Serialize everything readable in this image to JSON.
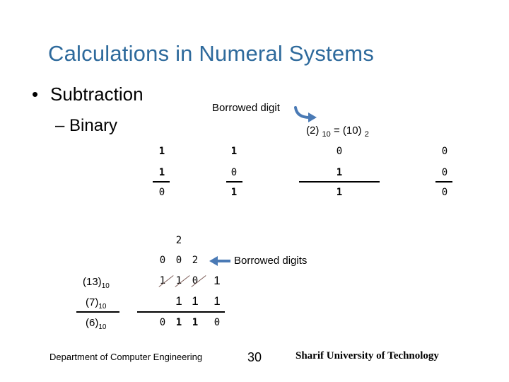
{
  "slide": {
    "title": "Calculations in Numeral Systems",
    "bullet_level1": "Subtraction",
    "bullet_level1_marker": "•",
    "bullet_level2": "Binary",
    "bullet_level2_marker": "–",
    "annotation_top": "Borrowed digit",
    "equation": {
      "left": "(2)",
      "left_base": "10",
      "equals": "=",
      "right": "(10)",
      "right_base": "2"
    },
    "columns": [
      {
        "minuend": "1",
        "subtrahend": "1",
        "result": "0"
      },
      {
        "minuend": "1",
        "subtrahend": "0",
        "result": "1"
      },
      {
        "minuend": "0",
        "subtrahend": "1",
        "result": "1"
      },
      {
        "minuend": "0",
        "subtrahend": "0",
        "result": "0"
      }
    ],
    "example": {
      "top_borrow": "2",
      "borrowed_digits": [
        "0",
        "0",
        "2"
      ],
      "borrowed_label": "Borrowed digits",
      "minuend_label": "(13)",
      "minuend_base": "10",
      "minuend_digits": [
        "1",
        "1",
        "0",
        "1"
      ],
      "subtrahend_label": "(7)",
      "subtrahend_base": "10",
      "subtrahend_digits": [
        "1",
        "1",
        "1"
      ],
      "result_label": "(6)",
      "result_base": "10",
      "result_digits": [
        "0",
        "1",
        "1",
        "0"
      ]
    },
    "footer": {
      "department": "Department of Computer Engineering",
      "page": "30",
      "university": "Sharif University of Technology"
    },
    "colors": {
      "title": "#2e6a9c",
      "arrow": "#4a7ab5"
    }
  }
}
